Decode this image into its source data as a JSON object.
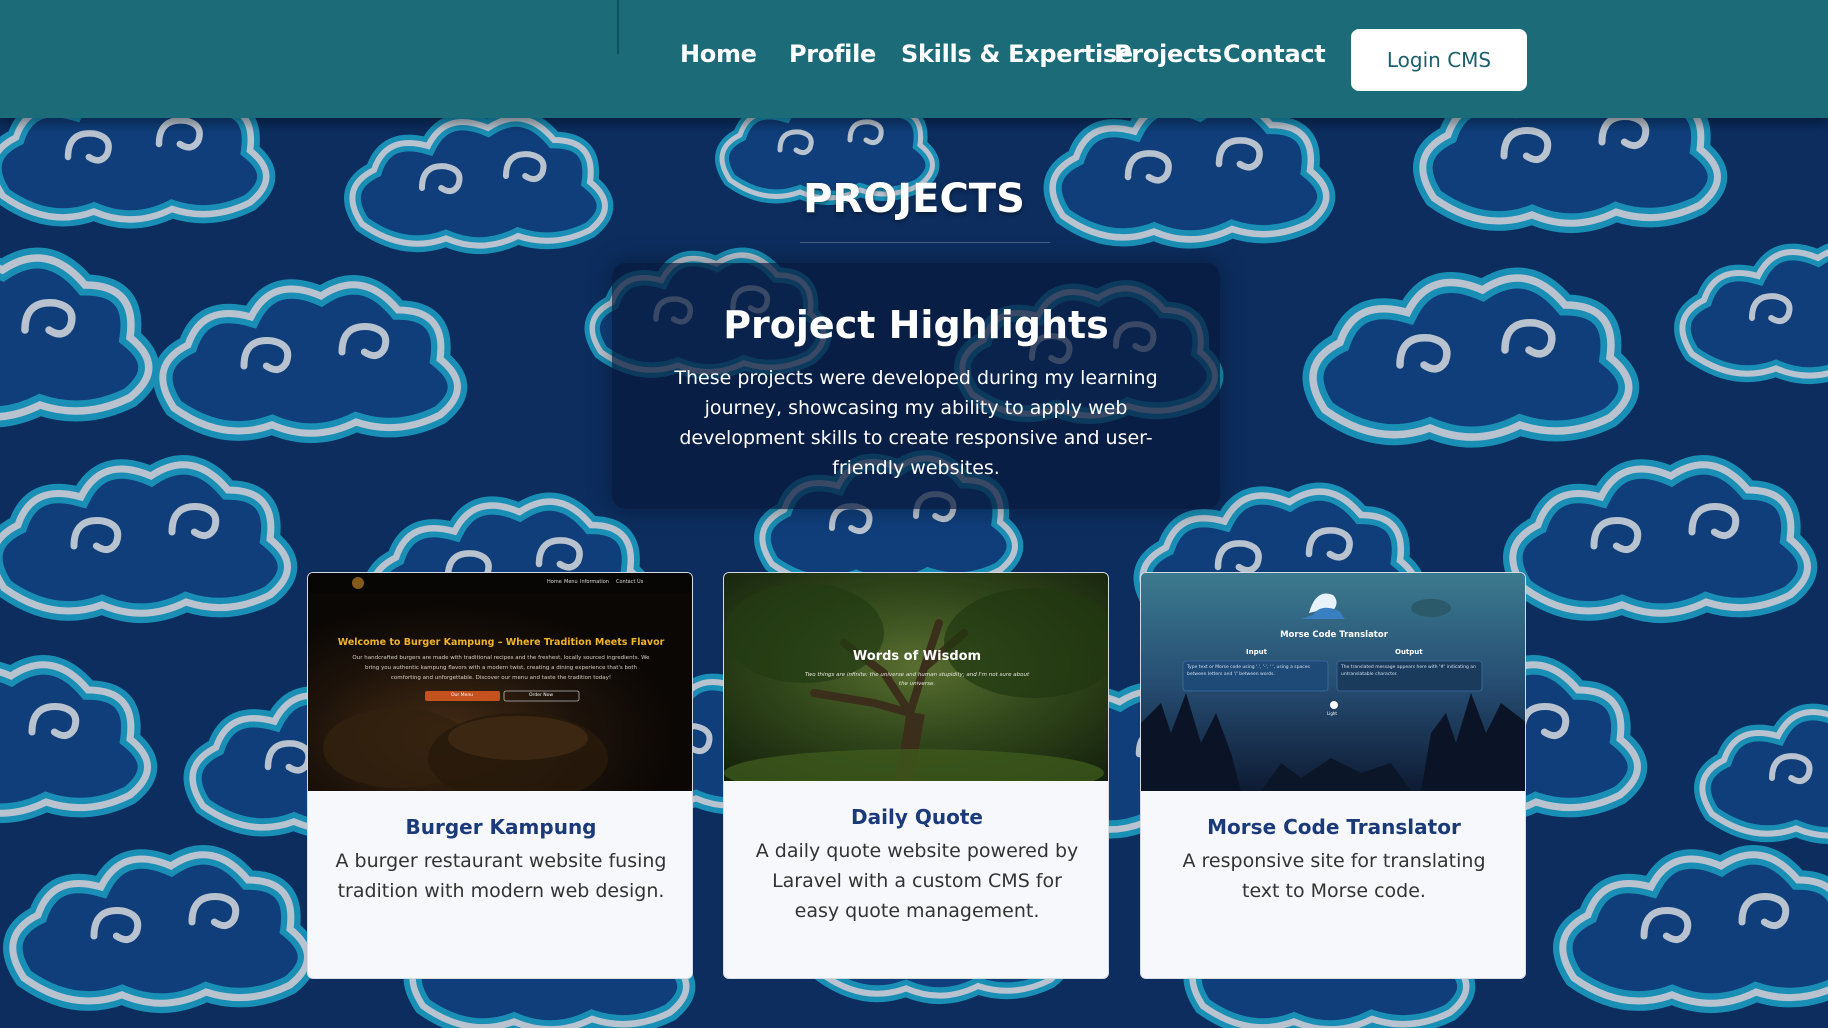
{
  "nav": {
    "links": [
      "Home",
      "Profile",
      "Skills & Expertise",
      "Projects",
      "Contact"
    ],
    "login_label": "Login CMS"
  },
  "section": {
    "title": "PROJECTS"
  },
  "highlights": {
    "title": "Project Highlights",
    "text": "These projects were developed during my learning journey, showcasing my ability to apply web development skills to create responsive and user-friendly websites."
  },
  "projects": [
    {
      "title": "Burger Kampung",
      "description": "A burger restaurant website fusing tradition with modern web design.",
      "thumb": {
        "nav_links": [
          "Home",
          "Menu",
          "Information",
          "Contact Us"
        ],
        "heading": "Welcome to Burger Kampung – Where Tradition Meets Flavor",
        "body": "Our handcrafted burgers are made with traditional recipes and the freshest, locally sourced ingredients. We bring you authentic kampung flavors with a modern twist, creating a dining experience that's both comforting and unforgettable. Discover our menu and taste the tradition today!",
        "button_1": "Our Menu",
        "button_2": "Order Now"
      }
    },
    {
      "title": "Daily Quote",
      "description": "A daily quote website powered by Laravel with a custom CMS for easy quote management.",
      "thumb": {
        "heading": "Words of Wisdom",
        "quote": "Two things are infinite: the universe and human stupidity; and I'm not sure about the universe."
      }
    },
    {
      "title": "Morse Code Translator",
      "description": "A responsive site for translating text to Morse code.",
      "thumb": {
        "heading": "Morse Code Translator",
        "input_label": "Input",
        "output_label": "Output",
        "input_placeholder": "Type text or Morse code using '.', '-', ' ', using a spaces between letters and '/' between words.",
        "output_placeholder": "The translated message appears here with '#' indicating an untranslatable character.",
        "toggle_label": "Light"
      }
    }
  ],
  "colors": {
    "navbar": "#1b6b78",
    "background": "#0c2d5e",
    "pattern_light": "#b9c3cf",
    "pattern_cyan": "#1a8fb5",
    "card_title": "#1a3a7a"
  }
}
